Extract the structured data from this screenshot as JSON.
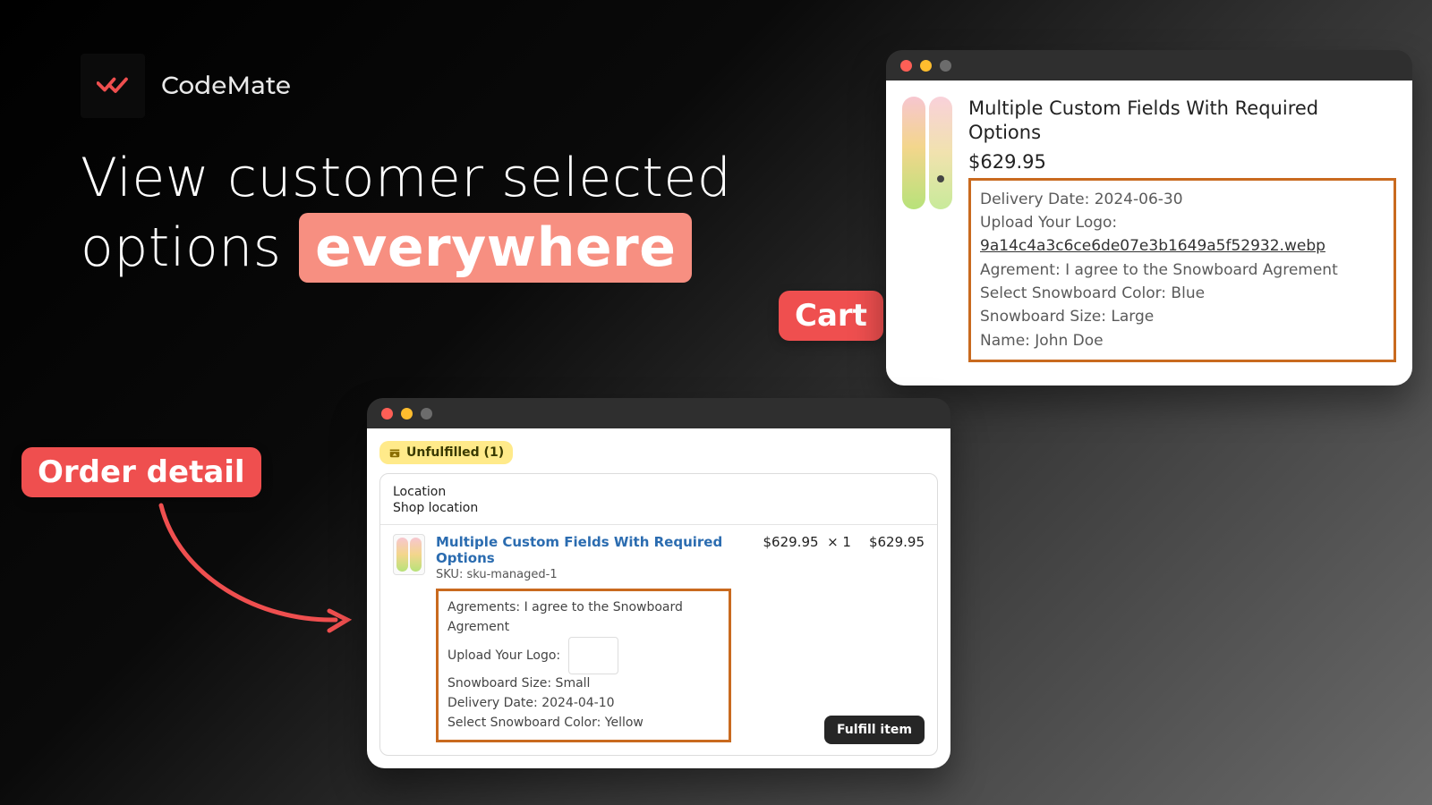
{
  "brand": {
    "name": "CodeMate"
  },
  "headline": {
    "line1": "View customer selected",
    "line2_pre": "options ",
    "highlight": "everywhere"
  },
  "labels": {
    "cart": "Cart",
    "order_detail": "Order detail"
  },
  "cart_window": {
    "title": "Multiple Custom Fields With Required Options",
    "price": "$629.95",
    "options": {
      "delivery_date": "Delivery Date: 2024-06-30",
      "upload_label": "Upload Your Logo:",
      "upload_file": "9a14c4a3c6ce6de07e3b1649a5f52932.webp",
      "agreement": "Agrement: I agree to the Snowboard Agrement",
      "color": "Select Snowboard Color: Blue",
      "size": "Snowboard Size: Large",
      "name": "Name: John Doe"
    }
  },
  "order_window": {
    "pill": "Unfulfilled (1)",
    "location_label": "Location",
    "location_value": "Shop location",
    "item": {
      "title": "Multiple Custom Fields With Required Options",
      "sku": "SKU: sku-managed-1",
      "unit_price": "$629.95",
      "qty": "×  1",
      "line_total": "$629.95"
    },
    "options": {
      "agreement": "Agrements: I agree to the Snowboard Agrement",
      "upload_label": "Upload Your Logo:",
      "size": "Snowboard Size: Small",
      "delivery_date": "Delivery Date: 2024-04-10",
      "color": "Select Snowboard Color: Yellow"
    },
    "fulfill_label": "Fulfill item"
  }
}
